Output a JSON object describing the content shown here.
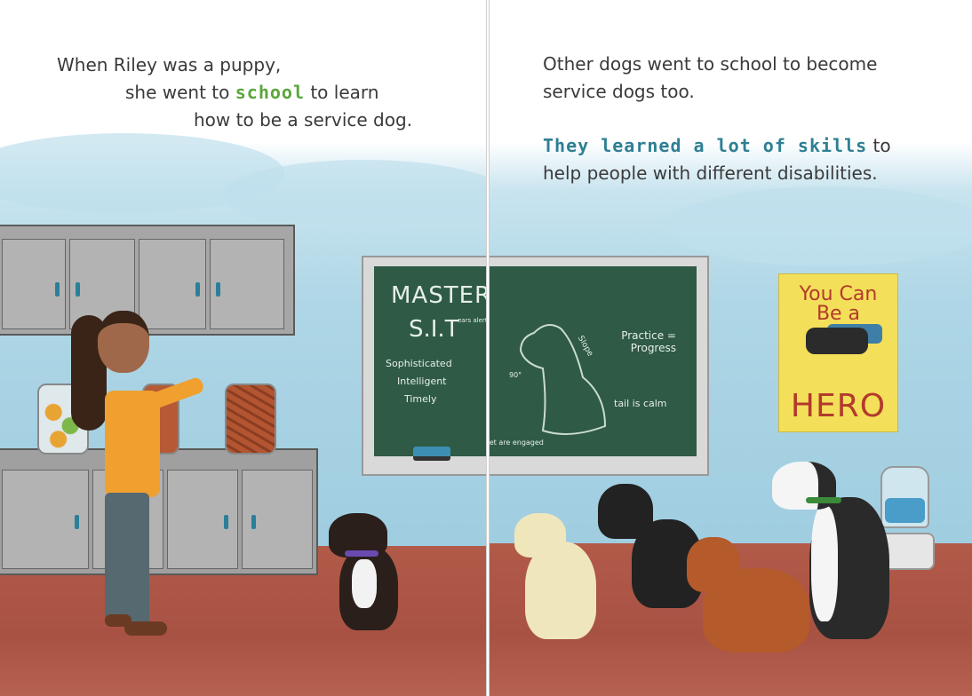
{
  "left_page": {
    "text_line1": "When Riley was a puppy,",
    "text_line2_before": "she went to ",
    "text_line2_highlight": "school",
    "text_line2_after": " to learn",
    "text_line3": "how to be a service dog."
  },
  "right_page": {
    "text_line1": "Other dogs went to school to become",
    "text_line2": "service dogs too.",
    "text_line3_highlight": "They learned a lot of skills",
    "text_line3_after": " to",
    "text_line4": "help people with different disabilities."
  },
  "chalkboard": {
    "title": "MASTER A PROPER",
    "acronym": "S.I.T",
    "items": [
      "Sophisticated",
      "Intelligent",
      "Timely"
    ],
    "note_ears": "ears alert",
    "note_practice": "Practice = Progress",
    "note_slope": "Slope",
    "note_angle": "90°",
    "note_tail": "tail is calm",
    "note_feet": "feet are engaged"
  },
  "poster": {
    "line1": "You Can",
    "line2": "Be a",
    "line3": "HERO"
  },
  "colors": {
    "green": "#5aa63a",
    "blue": "#2e7f93",
    "board": "#2f5a46",
    "floor": "#b25a48",
    "poster": "#f4df5a"
  }
}
